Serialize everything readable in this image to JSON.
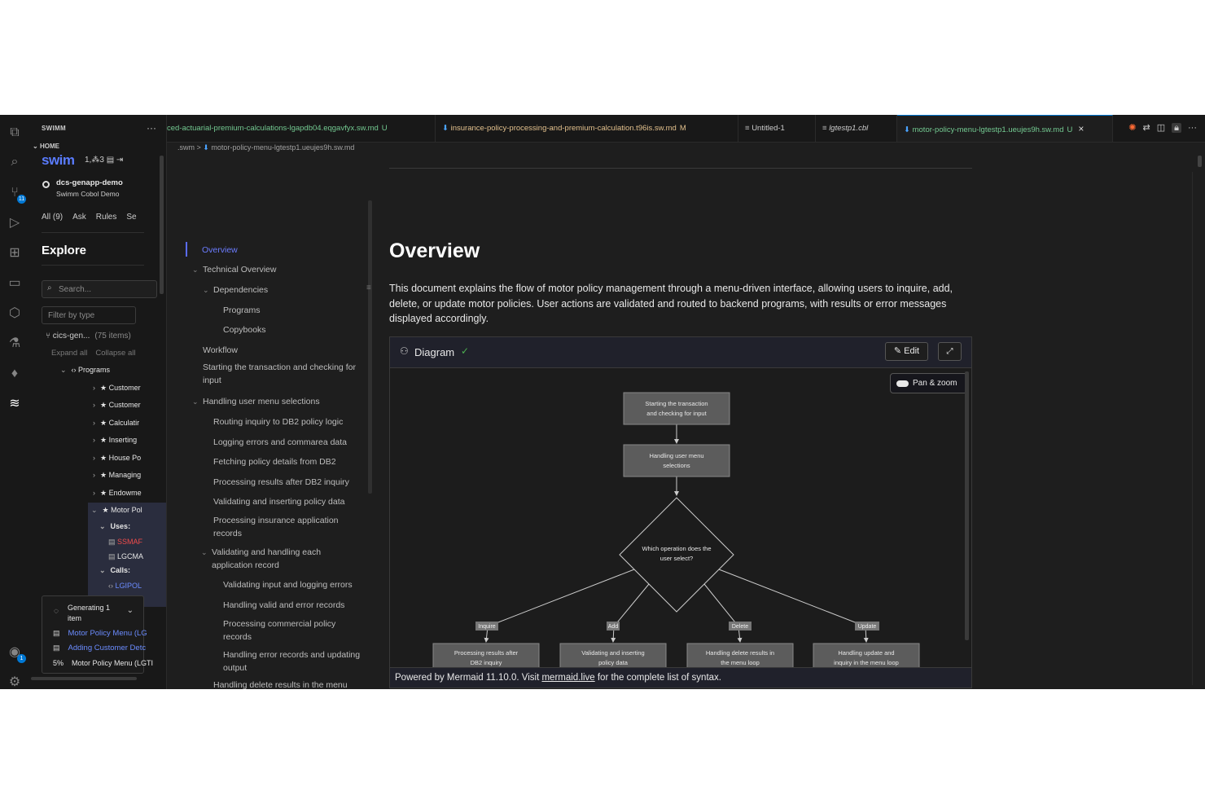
{
  "activity_bar": {
    "icons": [
      "explorer-icon",
      "search-icon",
      "source-control-icon",
      "run-debug-icon",
      "extensions-icon",
      "remote-explorer-icon",
      "packages-icon",
      "testing-icon",
      "mongo-icon",
      "swimm-icon",
      "account-icon",
      "settings-icon"
    ],
    "source_control_badge": "11",
    "account_badge": "1"
  },
  "sidebar": {
    "header": "SWIMM",
    "menu": "···",
    "home_label": "HOME",
    "logo_text": "swim",
    "logo_version": "1,⁂3",
    "repo_name": "dcs-genapp-demo",
    "repo_subtitle": "Swimm Cobol Demo",
    "filters": [
      "All (9)",
      "Ask",
      "Rules",
      "Se"
    ],
    "explore_title": "Explore",
    "search_placeholder": "Search...",
    "filter_placeholder": "Filter by type",
    "tree_root": "cics-gen...",
    "tree_count": "(75 items)",
    "expand_all": "Expand all",
    "collapse_all": "Collapse all",
    "programs_label": "Programs",
    "program_items": [
      "Customer",
      "Customer",
      "Calculatir",
      "Inserting",
      "House Po",
      "Managing",
      "Endowme",
      "Motor Pol"
    ],
    "uses_label": "Uses:",
    "uses_items": [
      "SSMAF",
      "LGCMA"
    ],
    "calls_label": "Calls:",
    "calls_items": [
      "LGIPOL"
    ],
    "generating_text": "Generating 1 item",
    "generating_items": [
      {
        "prefix": "",
        "label": "Motor Policy Menu (LG"
      },
      {
        "prefix": "",
        "label": "Adding Customer Detc"
      },
      {
        "prefix": "5%",
        "label": "Motor Policy Menu (LGTI"
      }
    ]
  },
  "tabs": [
    {
      "label": "ced-actuarial-premium-calculations-lgapdb04.eqgavfyx.sw.md",
      "marker": "U",
      "color": "#73c991"
    },
    {
      "label": "insurance-policy-processing-and-premium-calculation.t96is.sw.md",
      "marker": "M",
      "color": "#e2c08d"
    },
    {
      "label": "Untitled-1",
      "marker": "",
      "color": "#cccccc"
    },
    {
      "label": "lgtestp1.cbl",
      "marker": "",
      "color": "#cccccc"
    },
    {
      "label": "motor-policy-menu-lgtestp1.ueujes9h.sw.md",
      "marker": "U",
      "color": "#73c991"
    }
  ],
  "tab_close": "×",
  "breadcrumb": {
    "folder": ".swm",
    "sep": ">",
    "file": "motor-policy-menu-lgtestp1.ueujes9h.sw.md"
  },
  "toc": [
    {
      "label": "Overview",
      "level": 0,
      "active": true
    },
    {
      "label": "Technical Overview",
      "level": 0,
      "chevron": true
    },
    {
      "label": "Dependencies",
      "level": 1,
      "chevron": true
    },
    {
      "label": "Programs",
      "level": 2
    },
    {
      "label": "Copybooks",
      "level": 2
    },
    {
      "label": "Workflow",
      "level": 0
    },
    {
      "label": "Starting the transaction and checking for input",
      "level": 0
    },
    {
      "label": "Handling user menu selections",
      "level": 0,
      "chevron": true
    },
    {
      "label": "Routing inquiry to DB2 policy logic",
      "level": 1
    },
    {
      "label": "Logging errors and commarea data",
      "level": 1
    },
    {
      "label": "Fetching policy details from DB2",
      "level": 1
    },
    {
      "label": "Processing results after DB2 inquiry",
      "level": 1
    },
    {
      "label": "Validating and inserting policy data",
      "level": 1
    },
    {
      "label": "Processing insurance application records",
      "level": 1
    },
    {
      "label": "Validating and handling each application record",
      "level": 1,
      "chevron": true
    },
    {
      "label": "Validating input and logging errors",
      "level": 2
    },
    {
      "label": "Handling valid and error records",
      "level": 2
    },
    {
      "label": "Processing commercial policy records",
      "level": 2
    },
    {
      "label": "Handling error records and updating output",
      "level": 2
    },
    {
      "label": "Handling delete results in the menu",
      "level": 1
    }
  ],
  "doc": {
    "title": "Overview",
    "paragraph": "This document explains the flow of motor policy management through a menu-driven interface, allowing users to inquire, add, delete, or update motor policies. User actions are validated and routed to backend programs, with results or error messages displayed accordingly."
  },
  "diagram": {
    "title": "Diagram",
    "edit_label": "Edit",
    "pan_zoom_label": "Pan & zoom",
    "footer_prefix": "Powered by Mermaid 11.10.0. Visit ",
    "footer_link": "mermaid.live",
    "footer_suffix": " for the complete list of syntax.",
    "nodes": {
      "start": [
        "Starting the transaction",
        "and checking for input"
      ],
      "menu": [
        "Handling user menu",
        "selections"
      ],
      "decision": [
        "Which operation does the",
        "user select?"
      ],
      "inquire": [
        "Processing results after",
        "DB2 inquiry"
      ],
      "add": [
        "Validating and inserting",
        "policy data"
      ],
      "delete": [
        "Handling delete results in",
        "the menu loop"
      ],
      "update": [
        "Handling update and",
        "inquiry in the menu loop"
      ]
    },
    "edge_labels": [
      "Inquire",
      "Add",
      "Delete",
      "Update"
    ]
  },
  "colors": {
    "accent": "#0078d4",
    "link": "#6b8cff",
    "node_fill": "#5c5c5c",
    "background": "#1e1e1e"
  }
}
